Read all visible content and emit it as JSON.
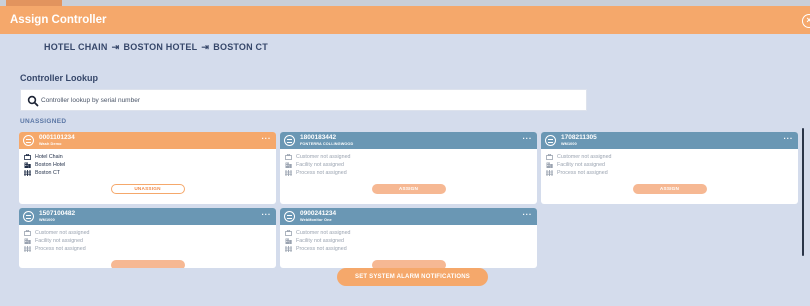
{
  "header": {
    "title": "Assign Controller",
    "close_icon": "close-circle-icon"
  },
  "breadcrumb": {
    "items": [
      "HOTEL CHAIN",
      "BOSTON HOTEL",
      "BOSTON CT"
    ],
    "separator_icon": "arrow-right-bar-icon"
  },
  "lookup": {
    "title": "Controller Lookup",
    "placeholder": "Controller lookup by serial number",
    "value": ""
  },
  "unassigned_label": "UNASSIGNED",
  "cards": [
    {
      "serial": "0001101234",
      "model": "Wash Demo",
      "rows": [
        "Hotel Chain",
        "Boston Hotel",
        "Boston CT"
      ],
      "button": "UNASSIGN",
      "active": true
    },
    {
      "serial": "1800183442",
      "model": "FONTERRA COLLINGWOOD",
      "rows": [
        "Customer not assigned",
        "Facility not assigned",
        "Process not assigned"
      ],
      "button": "ASSIGN",
      "active": false
    },
    {
      "serial": "1708211305",
      "model": "WM1000",
      "rows": [
        "Customer not assigned",
        "Facility not assigned",
        "Process not assigned"
      ],
      "button": "ASSIGN",
      "active": false
    },
    {
      "serial": "1507100482",
      "model": "WM1000",
      "rows": [
        "Customer not assigned",
        "Facility not assigned",
        "Process not assigned"
      ],
      "button": "",
      "active": false
    },
    {
      "serial": "0900241234",
      "model": "WebMonitor One",
      "rows": [
        "Customer not assigned",
        "Facility not assigned",
        "Process not assigned"
      ],
      "button": "",
      "active": false
    }
  ],
  "row_icons": [
    "briefcase-icon",
    "building-icon",
    "process-grid-icon"
  ],
  "alarm_button": "SET SYSTEM ALARM NOTIFICATIONS",
  "colors": {
    "accent": "#f5a86b",
    "card_header": "#6a97b4",
    "background": "#d4dcec"
  }
}
